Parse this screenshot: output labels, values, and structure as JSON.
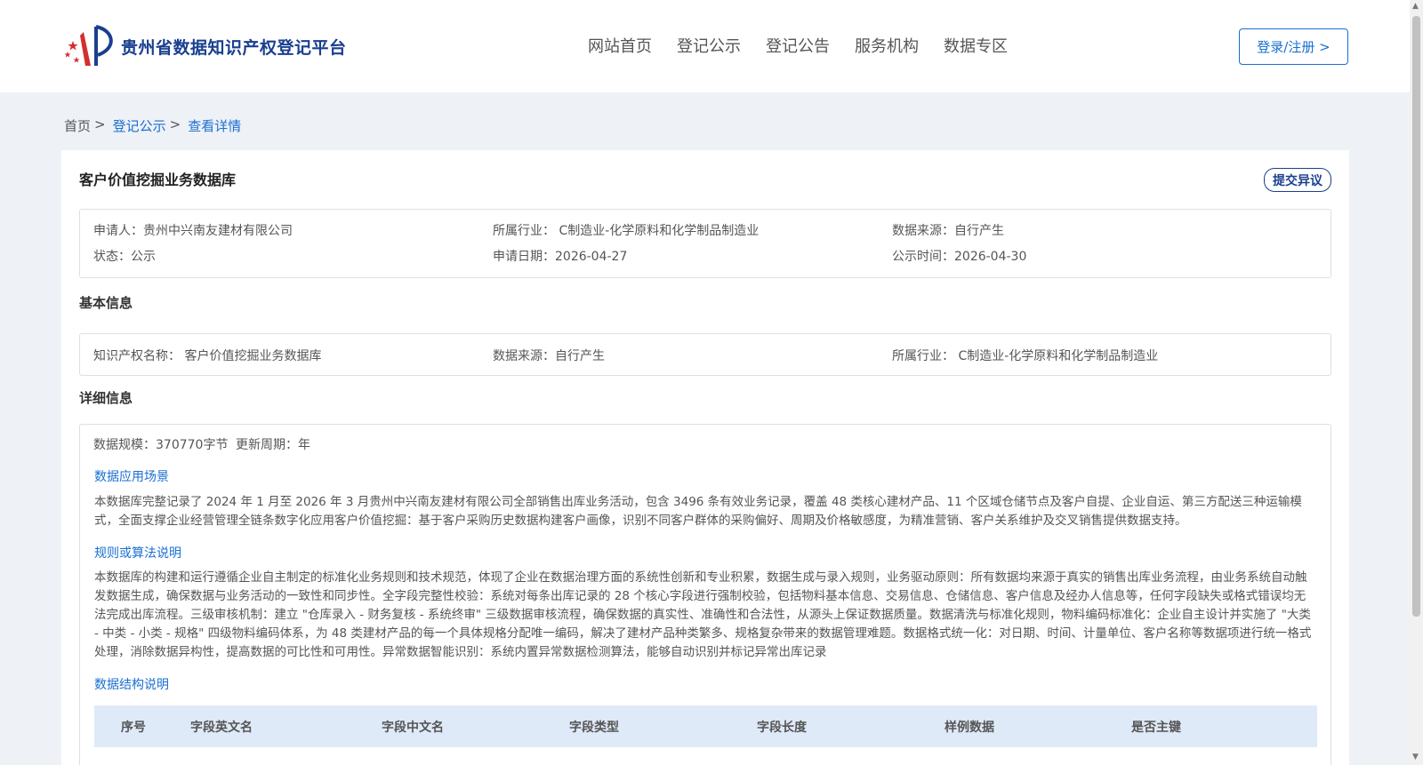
{
  "header": {
    "logo_text": "贵州省数据知识产权登记平台",
    "nav": [
      "网站首页",
      "登记公示",
      "登记公告",
      "服务机构",
      "数据专区"
    ],
    "login_label": "登录/注册 >"
  },
  "breadcrumb": {
    "home": "首页",
    "level2": "登记公示",
    "level3": "查看详情",
    "sep": ">"
  },
  "record": {
    "title": "客户价值挖掘业务数据库",
    "objection_label": "提交异议",
    "applicant": "申请人：贵州中兴南友建材有限公司",
    "industry": "所属行业： C制造业-化学原料和化学制品制造业",
    "data_source": "数据来源：自行产生",
    "status": "状态：公示",
    "apply_date": "申请日期：2026-04-27",
    "publish_time": "公示时间：2026-04-30"
  },
  "basic_info": {
    "title": "基本信息",
    "ip_name": "知识产权名称： 客户价值挖掘业务数据库",
    "data_source": "数据来源：自行产生",
    "industry": "所属行业： C制造业-化学原料和化学制品制造业"
  },
  "detail_info": {
    "title": "详细信息",
    "scale": "数据规模：370770字节",
    "update_cycle": "更新周期：年",
    "scenario_title": "数据应用场景",
    "scenario_text": "本数据库完整记录了 2024 年 1 月至 2026 年 3 月贵州中兴南友建材有限公司全部销售出库业务活动，包含 3496 条有效业务记录，覆盖 48 类核心建材产品、11 个区域仓储节点及客户自提、企业自运、第三方配送三种运输模式，全面支撑企业经营管理全链条数字化应用客户价值挖掘：基于客户采购历史数据构建客户画像，识别不同客户群体的采购偏好、周期及价格敏感度，为精准营销、客户关系维护及交叉销售提供数据支持。",
    "rules_title": "规则或算法说明",
    "rules_text": "本数据库的构建和运行遵循企业自主制定的标准化业务规则和技术规范，体现了企业在数据治理方面的系统性创新和专业积累，数据生成与录入规则，业务驱动原则：所有数据均来源于真实的销售出库业务流程，由业务系统自动触发数据生成，确保数据与业务活动的一致性和同步性。全字段完整性校验：系统对每条出库记录的 28 个核心字段进行强制校验，包括物料基本信息、交易信息、仓储信息、客户信息及经办人信息等，任何字段缺失或格式错误均无法完成出库流程。三级审核机制：建立 \"仓库录入 - 财务复核 - 系统终审\" 三级数据审核流程，确保数据的真实性、准确性和合法性，从源头上保证数据质量。数据清洗与标准化规则，物料编码标准化：企业自主设计并实施了 \"大类 - 中类 - 小类 - 规格\" 四级物料编码体系，为 48 类建材产品的每一个具体规格分配唯一编码，解决了建材产品种类繁多、规格复杂带来的数据管理难题。数据格式统一化：对日期、时间、计量单位、客户名称等数据项进行统一格式处理，消除数据异构性，提高数据的可比性和可用性。异常数据智能识别：系统内置异常数据检测算法，能够自动识别并标记异常出库记录",
    "structure_title": "数据结构说明",
    "table_headers": [
      "序号",
      "字段英文名",
      "字段中文名",
      "字段类型",
      "字段长度",
      "样例数据",
      "是否主键"
    ]
  },
  "colors": {
    "brand": "#1a3f8f",
    "link": "#1a6fd1",
    "table_header_bg": "#dfeaf8"
  }
}
